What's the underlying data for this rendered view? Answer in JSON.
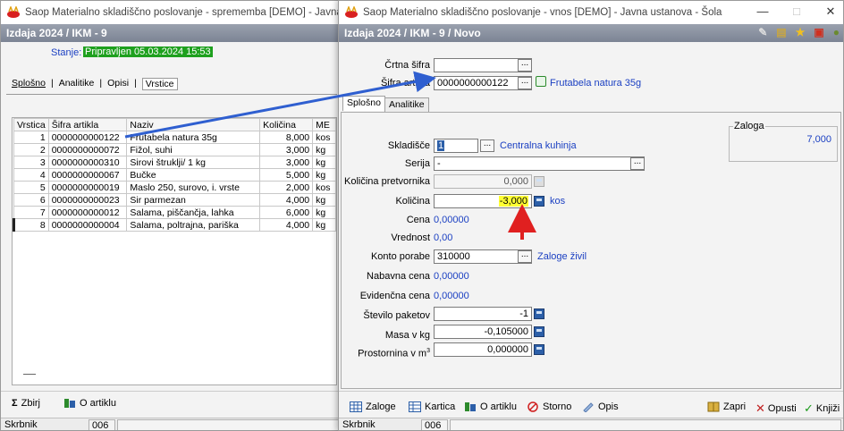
{
  "back_window": {
    "title": "Saop Materialno skladiščno poslovanje - sprememba [DEMO] - Javna ustanov",
    "header": "Izdaja 2024 / IKM - 9",
    "status_label": "Stanje:",
    "status_value": "Pripravljen 05.03.2024 15:53",
    "tabs": [
      "Splošno",
      "Analitike",
      "Opisi",
      "Vrstice"
    ],
    "grid": {
      "columns": [
        "Vrstica",
        "Šifra artikla",
        "Naziv",
        "Količina",
        "ME"
      ],
      "rows": [
        [
          "1",
          "0000000000122",
          "Frutabela natura 35g",
          "8,000",
          "kos"
        ],
        [
          "2",
          "0000000000072",
          "Fižol, suhi",
          "3,000",
          "kg"
        ],
        [
          "3",
          "0000000000310",
          "Sirovi štruklji/ 1 kg",
          "3,000",
          "kg"
        ],
        [
          "4",
          "0000000000067",
          "Bučke",
          "5,000",
          "kg"
        ],
        [
          "5",
          "0000000000019",
          "Maslo 250, surovo, i. vrste",
          "2,000",
          "kos"
        ],
        [
          "6",
          "0000000000023",
          "Sir parmezan",
          "4,000",
          "kg"
        ],
        [
          "7",
          "0000000000012",
          "Salama, piščančja, lahka",
          "6,000",
          "kg"
        ],
        [
          "8",
          "0000000000004",
          "Salama, poltrajna, pariška",
          "4,000",
          "kg"
        ]
      ]
    },
    "toolbar": {
      "zbirni": "Zbirj",
      "o_artiklu": "O artiklu"
    },
    "statusbar": {
      "user": "Skrbnik",
      "code": "006"
    }
  },
  "front_window": {
    "title": "Saop Materialno skladiščno poslovanje - vnos [DEMO] - Javna ustanova - Šola",
    "header": "Izdaja 2024 / IKM - 9 / Novo",
    "controls": {
      "minimize": "—",
      "maximize": "□",
      "close": "✕"
    },
    "crtna_sifra_label": "Črtna šifra",
    "sifra_label": "Šifra artikla",
    "sifra_value": "0000000000122",
    "sifra_name": "Frutabela natura 35g",
    "tabs": [
      "Splošno",
      "Analitike"
    ],
    "zaloga_label": "Zaloga",
    "zaloga_value": "7,000",
    "fields": {
      "skladisce_label": "Skladišče",
      "skladisce_value": "1",
      "skladisce_name": "Centralna kuhinja",
      "serija_label": "Serija",
      "serija_value": "-",
      "kolicina_pretvornika_label": "Količina pretvornika",
      "kolicina_pretvornika_value": "0,000",
      "kolicina_label": "Količina",
      "kolicina_value": "-3,000",
      "kolicina_unit": "kos",
      "cena_label": "Cena",
      "cena_value": "0,00000",
      "vrednost_label": "Vrednost",
      "vrednost_value": "0,00",
      "konto_label": "Konto porabe",
      "konto_value": "310000",
      "konto_name": "Zaloge živil",
      "nabavna_label": "Nabavna cena",
      "nabavna_value": "0,00000",
      "evidencna_label": "Evidenčna cena",
      "evidencna_value": "0,00000",
      "paketov_label": "Število paketov",
      "paketov_value": "-1",
      "masa_label": "Masa v kg",
      "masa_value": "-0,105000",
      "prostornina_label": "Prostornina v m",
      "prostornina_sup": "3",
      "prostornina_value": "0,000000"
    },
    "toolbar": {
      "zaloge": "Zaloge",
      "kartica": "Kartica",
      "o_artiklu": "O artiklu",
      "storno": "Storno",
      "opis": "Opis",
      "zapri": "Zapri",
      "opusti": "Opusti",
      "knjizi": "Knjiži"
    },
    "statusbar": {
      "user": "Skrbnik",
      "code": "006"
    }
  },
  "colors": {
    "header_bar": "#8a919f",
    "status_green": "#1ea01e",
    "highlight_yellow": "#ffff33",
    "link_blue": "#1a3fc2",
    "arrow_blue": "#2f5fd0",
    "arrow_red": "#e02020"
  }
}
